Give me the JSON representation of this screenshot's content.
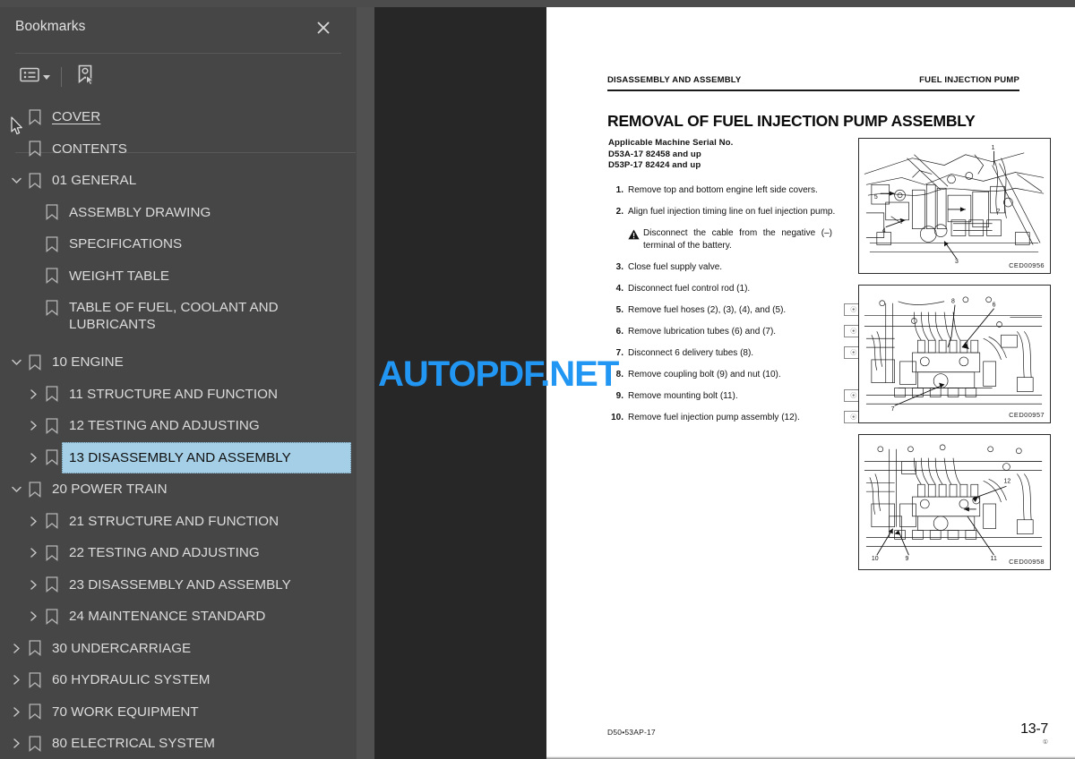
{
  "window": {
    "topbar_color": "#4c4c4c"
  },
  "sidebar": {
    "title": "Bookmarks",
    "close_icon": "close-icon",
    "toolbar": {
      "options_label": "Bookmark options",
      "options_icon": "list-options-icon",
      "options_caret_icon": "chevron-down-icon",
      "find_label": "Find bookmark for current page",
      "find_icon": "bookmark-pointer-icon"
    },
    "background": "#464646",
    "selected_background": "#a5cfe6",
    "items": [
      {
        "label": "COVER",
        "level": 0,
        "twisty": "none",
        "link": true,
        "selected": false
      },
      {
        "label": "CONTENTS",
        "level": 0,
        "twisty": "none",
        "link": false,
        "selected": false
      },
      {
        "label": "01 GENERAL",
        "level": 0,
        "twisty": "expanded",
        "link": false,
        "selected": false
      },
      {
        "label": "ASSEMBLY DRAWING",
        "level": 1,
        "twisty": "none",
        "link": false,
        "selected": false
      },
      {
        "label": "SPECIFICATIONS",
        "level": 1,
        "twisty": "none",
        "link": false,
        "selected": false
      },
      {
        "label": "WEIGHT TABLE",
        "level": 1,
        "twisty": "none",
        "link": false,
        "selected": false
      },
      {
        "label": "TABLE OF FUEL, COOLANT AND LUBRICANTS",
        "level": 1,
        "twisty": "none",
        "link": false,
        "selected": false,
        "twoline": true
      },
      {
        "label": "10 ENGINE",
        "level": 0,
        "twisty": "expanded",
        "link": false,
        "selected": false
      },
      {
        "label": "11 STRUCTURE AND FUNCTION",
        "level": 1,
        "twisty": "collapsed",
        "link": false,
        "selected": false
      },
      {
        "label": "12 TESTING AND ADJUSTING",
        "level": 1,
        "twisty": "collapsed",
        "link": false,
        "selected": false
      },
      {
        "label": "13 DISASSEMBLY AND ASSEMBLY",
        "level": 1,
        "twisty": "collapsed",
        "link": false,
        "selected": true
      },
      {
        "label": "20 POWER TRAIN",
        "level": 0,
        "twisty": "expanded",
        "link": false,
        "selected": false
      },
      {
        "label": "21 STRUCTURE AND FUNCTION",
        "level": 1,
        "twisty": "collapsed",
        "link": false,
        "selected": false
      },
      {
        "label": "22 TESTING AND ADJUSTING",
        "level": 1,
        "twisty": "collapsed",
        "link": false,
        "selected": false
      },
      {
        "label": "23 DISASSEMBLY AND ASSEMBLY",
        "level": 1,
        "twisty": "collapsed",
        "link": false,
        "selected": false
      },
      {
        "label": "24 MAINTENANCE STANDARD",
        "level": 1,
        "twisty": "collapsed",
        "link": false,
        "selected": false
      },
      {
        "label": "30 UNDERCARRIAGE",
        "level": 0,
        "twisty": "collapsed",
        "link": false,
        "selected": false
      },
      {
        "label": "60 HYDRAULIC SYSTEM",
        "level": 0,
        "twisty": "collapsed",
        "link": false,
        "selected": false
      },
      {
        "label": "70 WORK EQUIPMENT",
        "level": 0,
        "twisty": "collapsed",
        "link": false,
        "selected": false
      },
      {
        "label": "80 ELECTRICAL SYSTEM",
        "level": 0,
        "twisty": "collapsed",
        "link": false,
        "selected": false
      }
    ]
  },
  "splitter": {
    "collapse_icon": "triangle-left-icon",
    "tooltip": "Collapse sidebar"
  },
  "viewer": {
    "background": "#272727",
    "watermark": "AUTOPDF.NET",
    "watermark_color": "#2196f3"
  },
  "document": {
    "header_left": "DISASSEMBLY AND ASSEMBLY",
    "header_right": "FUEL INJECTION PUMP",
    "title": "REMOVAL OF FUEL INJECTION PUMP ASSEMBLY",
    "serial_heading": "Applicable Machine Serial No.",
    "serial_lines": [
      "D53A-17 82458 and up",
      "D53P-17 82424 and up"
    ],
    "steps": [
      {
        "num": "1.",
        "text": "Remove top and bottom engine left side covers.",
        "mark": null
      },
      {
        "num": "2.",
        "text": "Align fuel injection timing line on fuel injection pump.",
        "mark": null,
        "warning": "Disconnect the cable from the negative (–) terminal of the battery."
      },
      {
        "num": "3.",
        "text": "Close fuel supply valve.",
        "mark": null
      },
      {
        "num": "4.",
        "text": "Disconnect fuel control rod (1).",
        "mark": null
      },
      {
        "num": "5.",
        "text": "Remove fuel hoses (2), (3), (4), and (5).",
        "mark": "1"
      },
      {
        "num": "6.",
        "text": "Remove lubrication tubes (6) and (7).",
        "mark": "2"
      },
      {
        "num": "7.",
        "text": "Disconnect 6 delivery tubes (8).",
        "mark": "3"
      },
      {
        "num": "8.",
        "text": "Remove coupling bolt (9) and nut (10).",
        "mark": null
      },
      {
        "num": "9.",
        "text": "Remove mounting bolt (11).",
        "mark": "4"
      },
      {
        "num": "10.",
        "text": "Remove fuel injection pump assembly (12).",
        "mark": "5"
      }
    ],
    "figures": [
      {
        "code": "CED00956",
        "callouts": [
          "1",
          "2",
          "3",
          "4",
          "5"
        ]
      },
      {
        "code": "CED00957",
        "callouts": [
          "6",
          "7",
          "8"
        ]
      },
      {
        "code": "CED00958",
        "callouts": [
          "9",
          "10",
          "11",
          "12"
        ]
      }
    ],
    "footer_left": "D50•53AP-17",
    "page_number": "13-7",
    "page_revision": "①"
  }
}
